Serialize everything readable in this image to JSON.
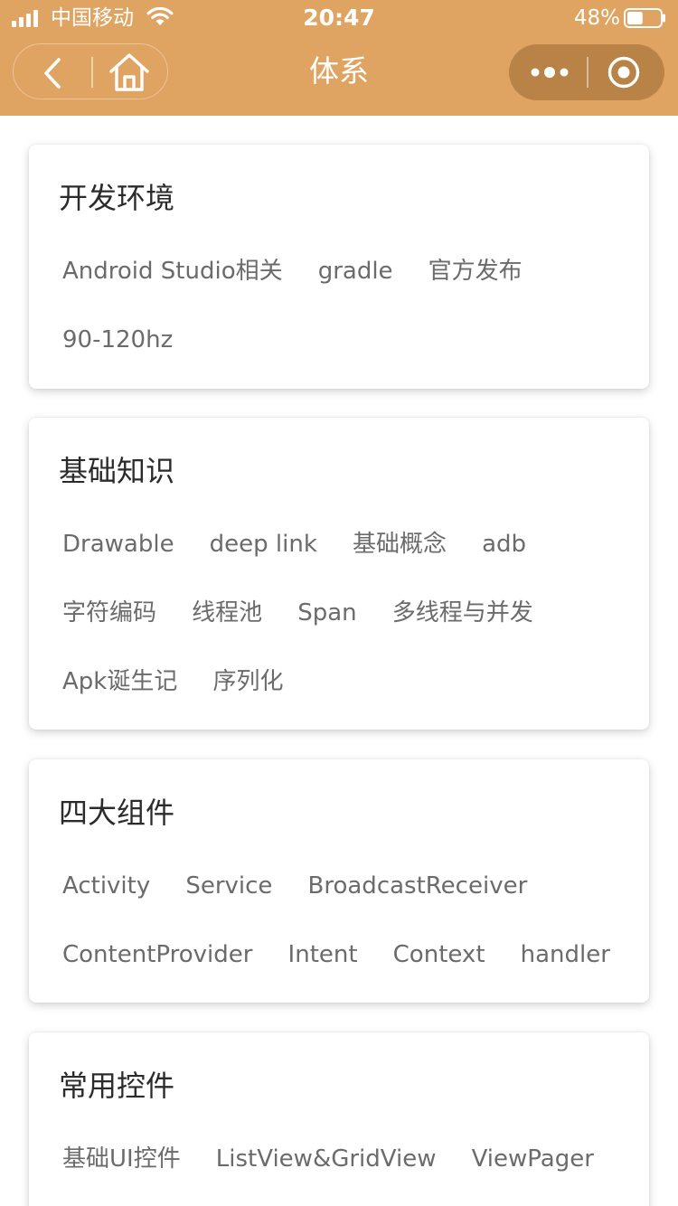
{
  "status_bar": {
    "carrier": "中国移动",
    "time": "20:47",
    "battery_percent": "48%",
    "battery_level": 0.48
  },
  "nav": {
    "title": "体系",
    "back_icon": "chevron-left-icon",
    "home_icon": "home-icon",
    "more_icon": "more-dots-icon",
    "close_icon": "target-circle-icon"
  },
  "colors": {
    "nav_bg": "#e0a462",
    "capsule_bg": "#b98347",
    "card_title": "#2b2b2b",
    "tag_text": "#6b6b6b"
  },
  "cards": [
    {
      "title": "开发环境",
      "rows": [
        [
          "Android Studio相关",
          "gradle",
          "官方发布"
        ],
        [
          "90-120hz"
        ]
      ]
    },
    {
      "title": "基础知识",
      "rows": [
        [
          "Drawable",
          "deep link",
          "基础概念",
          "adb"
        ],
        [
          "字符编码",
          "线程池",
          "Span",
          "多线程与并发"
        ],
        [
          "Apk诞生记",
          "序列化"
        ]
      ]
    },
    {
      "title": "四大组件",
      "rows": [
        [
          "Activity",
          "Service",
          "BroadcastReceiver"
        ],
        [
          "ContentProvider",
          "Intent",
          "Context",
          "handler"
        ]
      ]
    },
    {
      "title": "常用控件",
      "rows": [
        [
          "基础UI控件",
          "ListView&GridView",
          "ViewPager"
        ]
      ]
    }
  ]
}
